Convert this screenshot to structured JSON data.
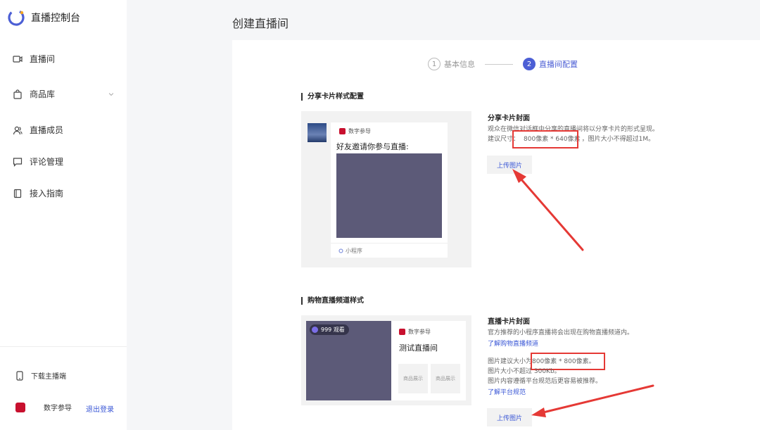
{
  "sidebar": {
    "app_title": "直播控制台",
    "items": [
      {
        "label": "直播间",
        "icon": "video-camera-icon"
      },
      {
        "label": "商品库",
        "icon": "shopping-bag-icon"
      },
      {
        "label": "直播成员",
        "icon": "users-icon"
      },
      {
        "label": "评论管理",
        "icon": "comment-icon"
      },
      {
        "label": "接入指南",
        "icon": "book-icon"
      }
    ],
    "download_label": "下载主播端",
    "username": "数字参导",
    "logout_label": "退出登录"
  },
  "page_title": "创建直播间",
  "steps": [
    {
      "number": "1",
      "label": "基本信息"
    },
    {
      "number": "2",
      "label": "直播间配置"
    }
  ],
  "share": {
    "section_title": "分享卡片样式配置",
    "brand_name": "数字参导",
    "invite_text": "好友邀请你参与直播:",
    "miniprogram_label": "小程序",
    "cover_title": "分享卡片封面",
    "desc_line1": "观众在微信对话框中分享的直播间将以分享卡片的形式呈现。",
    "desc_prefix": "建议尺寸：",
    "desc_size": "800像素 * 640像素",
    "desc_suffix": "，图片大小不得超过1M。",
    "upload_label": "上传图片"
  },
  "shopping": {
    "section_title": "购物直播频道样式",
    "viewers": "999 观看",
    "brand_name": "数字参导",
    "live_title": "测试直播间",
    "product_tile_label": "商品展示",
    "cover_title": "直播卡片封面",
    "desc_line1": "官方推荐的小程序直播将会出现在购物直播频道内。",
    "learn_link": "了解购物直播频道",
    "size_prefix": "图片建议大小为",
    "size_value": "800像素 * 800像素",
    "size_suffix": "。",
    "limit_text": "图片大小不超过 300Kb。",
    "rule_text": "图片内容遵循平台规范后更容易被推荐。",
    "rule_link": "了解平台规范",
    "upload_label": "上传图片"
  },
  "colors": {
    "accent": "#4c5fd5",
    "link": "#3a57d6",
    "highlight": "#e53935",
    "placeholder": "#5c5a78"
  }
}
